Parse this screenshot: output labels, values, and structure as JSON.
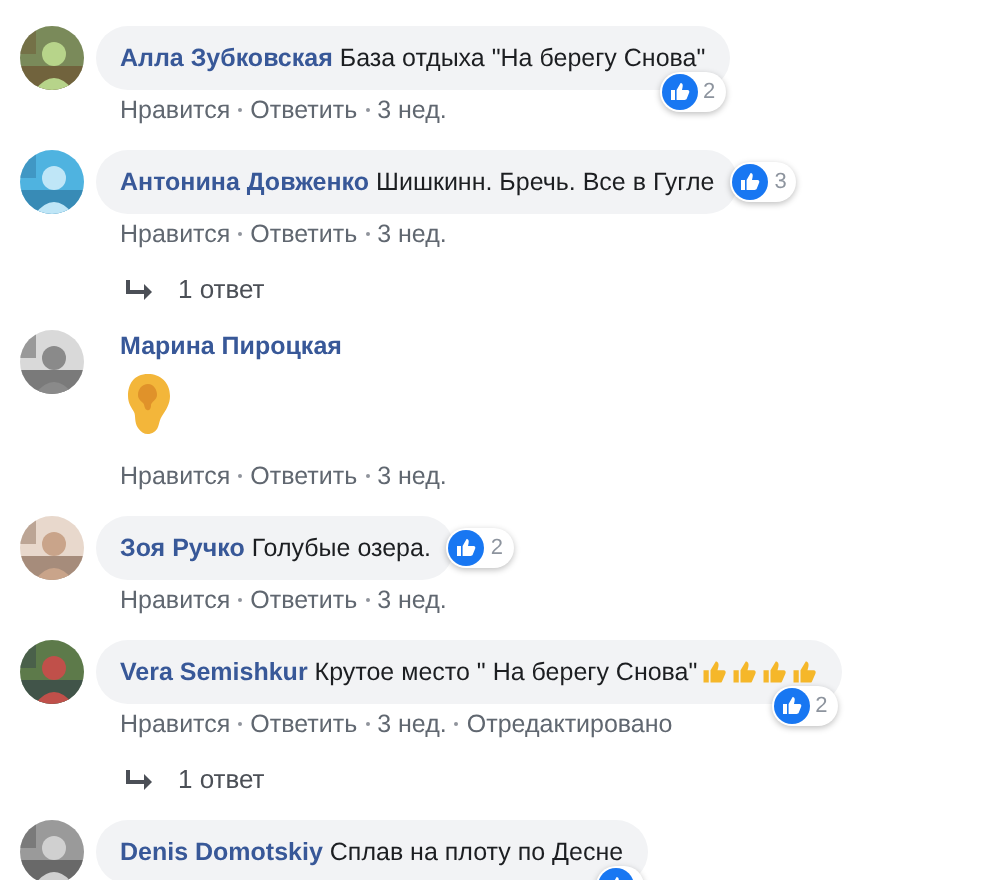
{
  "comments": [
    {
      "author": "Алла Зубковская",
      "kind": "text",
      "text": "База отдыха \"На берегу Снова\"",
      "reactions": {
        "count": "2",
        "at_corner": true
      },
      "actions": [
        "Нравится",
        "Ответить",
        "3 нед."
      ]
    },
    {
      "author": "Антонина Довженко",
      "kind": "text",
      "text": "Шишкинн. Бречь. Все в Гугле",
      "reactions": {
        "count": "3",
        "at_corner": false
      },
      "actions": [
        "Нравится",
        "Ответить",
        "3 нед."
      ],
      "replies": "1 ответ"
    },
    {
      "author": "Марина Пироцкая",
      "kind": "ear_sticker",
      "actions": [
        "Нравится",
        "Ответить",
        "3 нед."
      ]
    },
    {
      "author": "Зоя Ручко",
      "kind": "text",
      "text": "Голубые озера.",
      "reactions": {
        "count": "2",
        "at_corner": false
      },
      "actions": [
        "Нравится",
        "Ответить",
        "3 нед."
      ]
    },
    {
      "author": "Vera Semishkur",
      "kind": "text_with_thumbs",
      "text": "Крутое место \" На берегу Снова\"",
      "reactions": {
        "count": "2",
        "at_corner": true
      },
      "actions": [
        "Нравится",
        "Ответить",
        "3 нед.",
        "Отредактировано"
      ],
      "replies": "1 ответ"
    },
    {
      "author": "Denis Domotskiy",
      "kind": "text",
      "text": "Сплав на плоту по Десне",
      "reactions": {
        "at_corner": true
      }
    }
  ]
}
